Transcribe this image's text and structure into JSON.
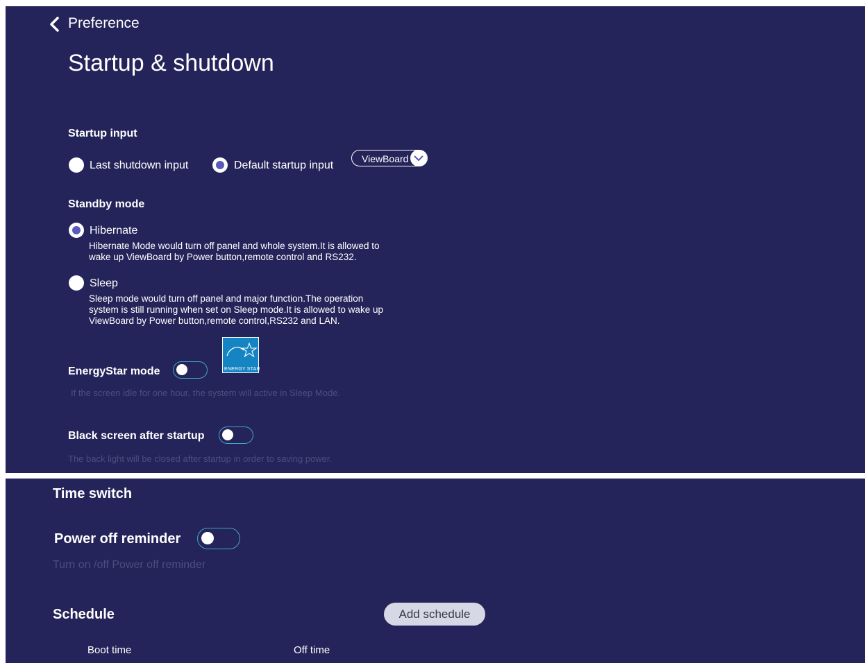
{
  "header": {
    "back_label": "Preference",
    "title": "Startup & shutdown"
  },
  "startup_input": {
    "title": "Startup input",
    "options": [
      {
        "label": "Last shutdown input",
        "selected": false
      },
      {
        "label": "Default startup input",
        "selected": true
      }
    ],
    "dropdown_value": "ViewBoard"
  },
  "standby_mode": {
    "title": "Standby mode",
    "options": [
      {
        "label": "Hibernate",
        "selected": true,
        "description_lines": [
          "Hibernate Mode would turn off panel and whole system.It is allowed to",
          "wake up ViewBoard by Power button,remote control and RS232."
        ]
      },
      {
        "label": "Sleep",
        "selected": false,
        "description_lines": [
          "Sleep mode would turn off panel and major function.The operation",
          "system is still running when set on Sleep mode.It is allowed to wake up",
          "ViewBoard by Power button,remote control,RS232 and LAN."
        ]
      }
    ]
  },
  "energystar": {
    "label": "EnergyStar mode",
    "enabled": false,
    "logo_text": "ENERGY STAR",
    "hint": "If the screen idle for one hour, the system will active in Sleep Mode."
  },
  "black_screen": {
    "label": "Black screen after startup",
    "enabled": false,
    "hint": "The back light will be closed after startup in order to saving power."
  },
  "time_switch": {
    "title": "Time switch",
    "power_off_reminder": {
      "label": "Power off reminder",
      "enabled": false,
      "hint": "Turn on /off Power off reminder"
    },
    "schedule": {
      "title": "Schedule",
      "add_button": "Add schedule",
      "columns": [
        "Boot time",
        "Off time"
      ]
    }
  },
  "colors": {
    "background": "#25245a",
    "radio_selected": "#5a5bb8",
    "toggle_border": "#40a6c4",
    "hint_text": "#4b4d7e",
    "energystar_blue": "#1584c2"
  }
}
